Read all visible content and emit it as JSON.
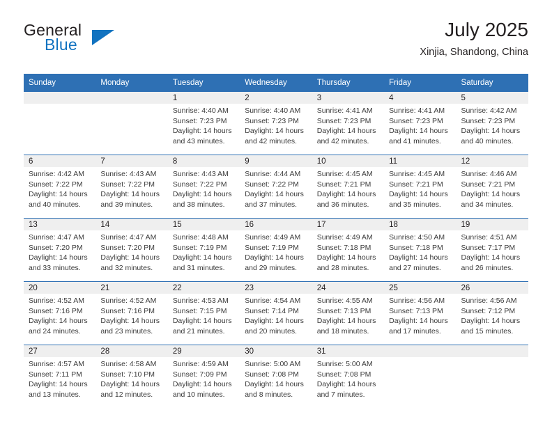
{
  "brand": {
    "name_part1": "General",
    "name_part2": "Blue",
    "logo_icon": "triangle-flag-icon"
  },
  "header": {
    "title": "July 2025",
    "subtitle": "Xinjia, Shandong, China"
  },
  "calendar": {
    "weekday_headers": [
      "Sunday",
      "Monday",
      "Tuesday",
      "Wednesday",
      "Thursday",
      "Friday",
      "Saturday"
    ],
    "colors": {
      "header_blue": "#2e70b4",
      "daynum_band": "#efefef",
      "brand_blue": "#1273c0",
      "text": "#231f20"
    },
    "weeks": [
      [
        {
          "day": "",
          "sunrise": "",
          "sunset": "",
          "daylight_line1": "",
          "daylight_line2": ""
        },
        {
          "day": "",
          "sunrise": "",
          "sunset": "",
          "daylight_line1": "",
          "daylight_line2": ""
        },
        {
          "day": "1",
          "sunrise": "Sunrise: 4:40 AM",
          "sunset": "Sunset: 7:23 PM",
          "daylight_line1": "Daylight: 14 hours",
          "daylight_line2": "and 43 minutes."
        },
        {
          "day": "2",
          "sunrise": "Sunrise: 4:40 AM",
          "sunset": "Sunset: 7:23 PM",
          "daylight_line1": "Daylight: 14 hours",
          "daylight_line2": "and 42 minutes."
        },
        {
          "day": "3",
          "sunrise": "Sunrise: 4:41 AM",
          "sunset": "Sunset: 7:23 PM",
          "daylight_line1": "Daylight: 14 hours",
          "daylight_line2": "and 42 minutes."
        },
        {
          "day": "4",
          "sunrise": "Sunrise: 4:41 AM",
          "sunset": "Sunset: 7:23 PM",
          "daylight_line1": "Daylight: 14 hours",
          "daylight_line2": "and 41 minutes."
        },
        {
          "day": "5",
          "sunrise": "Sunrise: 4:42 AM",
          "sunset": "Sunset: 7:23 PM",
          "daylight_line1": "Daylight: 14 hours",
          "daylight_line2": "and 40 minutes."
        }
      ],
      [
        {
          "day": "6",
          "sunrise": "Sunrise: 4:42 AM",
          "sunset": "Sunset: 7:22 PM",
          "daylight_line1": "Daylight: 14 hours",
          "daylight_line2": "and 40 minutes."
        },
        {
          "day": "7",
          "sunrise": "Sunrise: 4:43 AM",
          "sunset": "Sunset: 7:22 PM",
          "daylight_line1": "Daylight: 14 hours",
          "daylight_line2": "and 39 minutes."
        },
        {
          "day": "8",
          "sunrise": "Sunrise: 4:43 AM",
          "sunset": "Sunset: 7:22 PM",
          "daylight_line1": "Daylight: 14 hours",
          "daylight_line2": "and 38 minutes."
        },
        {
          "day": "9",
          "sunrise": "Sunrise: 4:44 AM",
          "sunset": "Sunset: 7:22 PM",
          "daylight_line1": "Daylight: 14 hours",
          "daylight_line2": "and 37 minutes."
        },
        {
          "day": "10",
          "sunrise": "Sunrise: 4:45 AM",
          "sunset": "Sunset: 7:21 PM",
          "daylight_line1": "Daylight: 14 hours",
          "daylight_line2": "and 36 minutes."
        },
        {
          "day": "11",
          "sunrise": "Sunrise: 4:45 AM",
          "sunset": "Sunset: 7:21 PM",
          "daylight_line1": "Daylight: 14 hours",
          "daylight_line2": "and 35 minutes."
        },
        {
          "day": "12",
          "sunrise": "Sunrise: 4:46 AM",
          "sunset": "Sunset: 7:21 PM",
          "daylight_line1": "Daylight: 14 hours",
          "daylight_line2": "and 34 minutes."
        }
      ],
      [
        {
          "day": "13",
          "sunrise": "Sunrise: 4:47 AM",
          "sunset": "Sunset: 7:20 PM",
          "daylight_line1": "Daylight: 14 hours",
          "daylight_line2": "and 33 minutes."
        },
        {
          "day": "14",
          "sunrise": "Sunrise: 4:47 AM",
          "sunset": "Sunset: 7:20 PM",
          "daylight_line1": "Daylight: 14 hours",
          "daylight_line2": "and 32 minutes."
        },
        {
          "day": "15",
          "sunrise": "Sunrise: 4:48 AM",
          "sunset": "Sunset: 7:19 PM",
          "daylight_line1": "Daylight: 14 hours",
          "daylight_line2": "and 31 minutes."
        },
        {
          "day": "16",
          "sunrise": "Sunrise: 4:49 AM",
          "sunset": "Sunset: 7:19 PM",
          "daylight_line1": "Daylight: 14 hours",
          "daylight_line2": "and 29 minutes."
        },
        {
          "day": "17",
          "sunrise": "Sunrise: 4:49 AM",
          "sunset": "Sunset: 7:18 PM",
          "daylight_line1": "Daylight: 14 hours",
          "daylight_line2": "and 28 minutes."
        },
        {
          "day": "18",
          "sunrise": "Sunrise: 4:50 AM",
          "sunset": "Sunset: 7:18 PM",
          "daylight_line1": "Daylight: 14 hours",
          "daylight_line2": "and 27 minutes."
        },
        {
          "day": "19",
          "sunrise": "Sunrise: 4:51 AM",
          "sunset": "Sunset: 7:17 PM",
          "daylight_line1": "Daylight: 14 hours",
          "daylight_line2": "and 26 minutes."
        }
      ],
      [
        {
          "day": "20",
          "sunrise": "Sunrise: 4:52 AM",
          "sunset": "Sunset: 7:16 PM",
          "daylight_line1": "Daylight: 14 hours",
          "daylight_line2": "and 24 minutes."
        },
        {
          "day": "21",
          "sunrise": "Sunrise: 4:52 AM",
          "sunset": "Sunset: 7:16 PM",
          "daylight_line1": "Daylight: 14 hours",
          "daylight_line2": "and 23 minutes."
        },
        {
          "day": "22",
          "sunrise": "Sunrise: 4:53 AM",
          "sunset": "Sunset: 7:15 PM",
          "daylight_line1": "Daylight: 14 hours",
          "daylight_line2": "and 21 minutes."
        },
        {
          "day": "23",
          "sunrise": "Sunrise: 4:54 AM",
          "sunset": "Sunset: 7:14 PM",
          "daylight_line1": "Daylight: 14 hours",
          "daylight_line2": "and 20 minutes."
        },
        {
          "day": "24",
          "sunrise": "Sunrise: 4:55 AM",
          "sunset": "Sunset: 7:13 PM",
          "daylight_line1": "Daylight: 14 hours",
          "daylight_line2": "and 18 minutes."
        },
        {
          "day": "25",
          "sunrise": "Sunrise: 4:56 AM",
          "sunset": "Sunset: 7:13 PM",
          "daylight_line1": "Daylight: 14 hours",
          "daylight_line2": "and 17 minutes."
        },
        {
          "day": "26",
          "sunrise": "Sunrise: 4:56 AM",
          "sunset": "Sunset: 7:12 PM",
          "daylight_line1": "Daylight: 14 hours",
          "daylight_line2": "and 15 minutes."
        }
      ],
      [
        {
          "day": "27",
          "sunrise": "Sunrise: 4:57 AM",
          "sunset": "Sunset: 7:11 PM",
          "daylight_line1": "Daylight: 14 hours",
          "daylight_line2": "and 13 minutes."
        },
        {
          "day": "28",
          "sunrise": "Sunrise: 4:58 AM",
          "sunset": "Sunset: 7:10 PM",
          "daylight_line1": "Daylight: 14 hours",
          "daylight_line2": "and 12 minutes."
        },
        {
          "day": "29",
          "sunrise": "Sunrise: 4:59 AM",
          "sunset": "Sunset: 7:09 PM",
          "daylight_line1": "Daylight: 14 hours",
          "daylight_line2": "and 10 minutes."
        },
        {
          "day": "30",
          "sunrise": "Sunrise: 5:00 AM",
          "sunset": "Sunset: 7:08 PM",
          "daylight_line1": "Daylight: 14 hours",
          "daylight_line2": "and 8 minutes."
        },
        {
          "day": "31",
          "sunrise": "Sunrise: 5:00 AM",
          "sunset": "Sunset: 7:08 PM",
          "daylight_line1": "Daylight: 14 hours",
          "daylight_line2": "and 7 minutes."
        },
        {
          "day": "",
          "sunrise": "",
          "sunset": "",
          "daylight_line1": "",
          "daylight_line2": ""
        },
        {
          "day": "",
          "sunrise": "",
          "sunset": "",
          "daylight_line1": "",
          "daylight_line2": ""
        }
      ]
    ]
  }
}
